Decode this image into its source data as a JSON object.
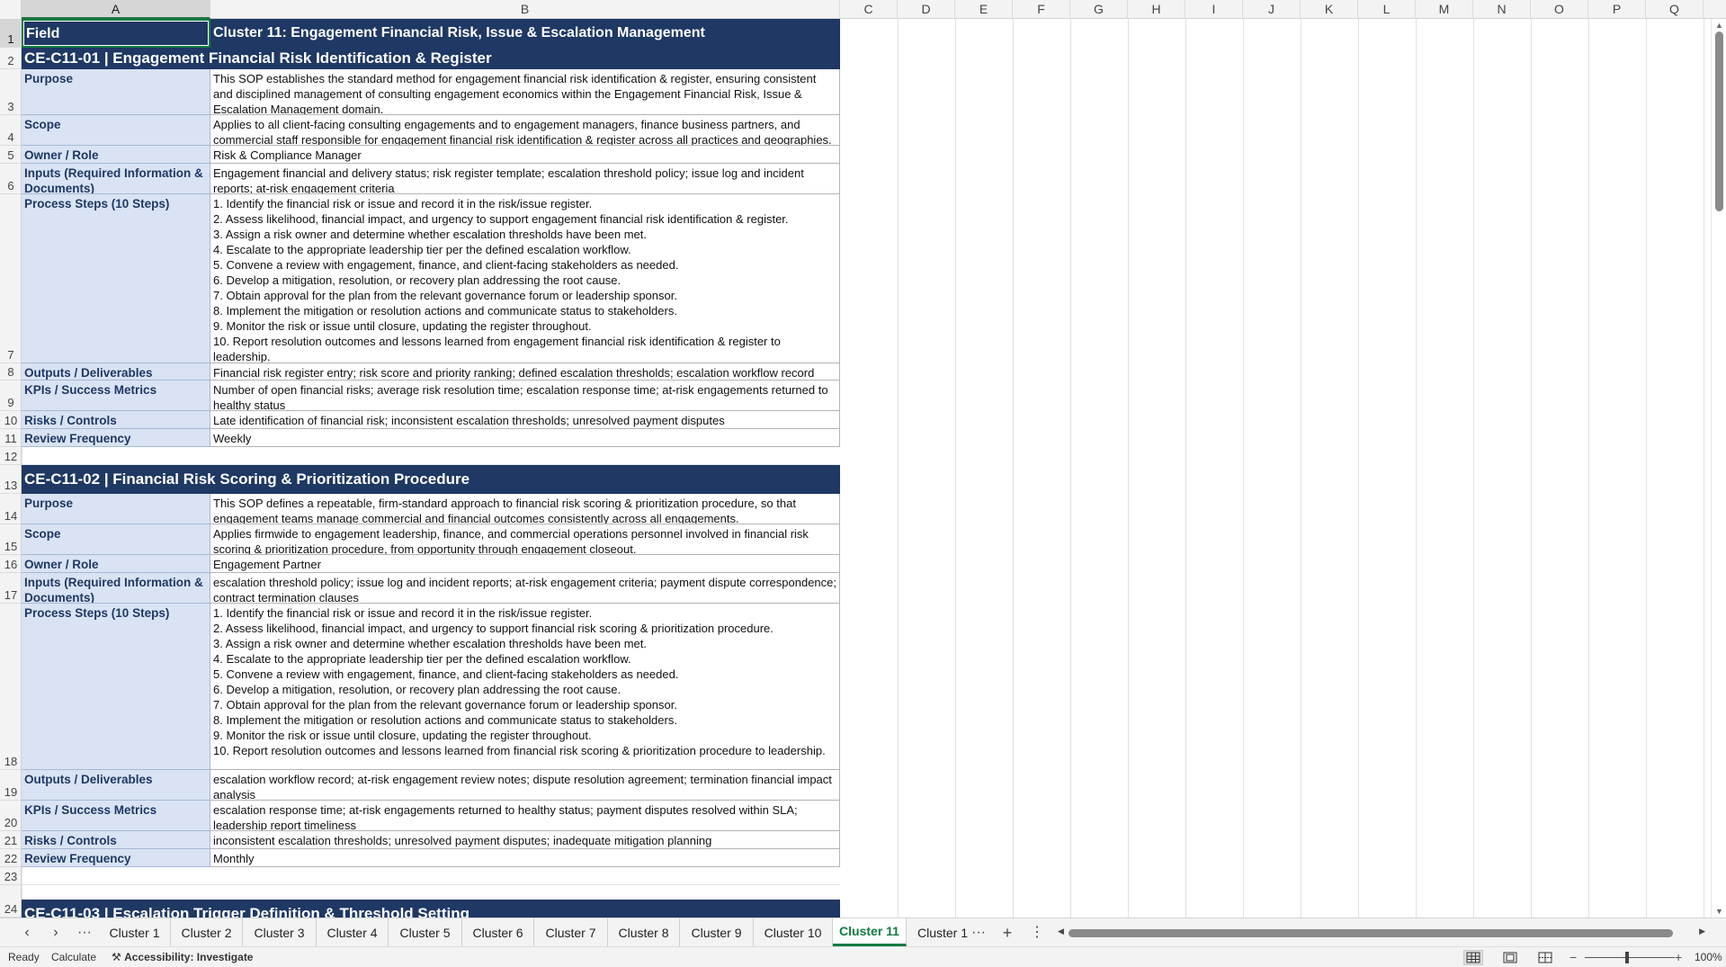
{
  "columns": [
    "A",
    "B",
    "C",
    "D",
    "E",
    "F",
    "G",
    "H",
    "I",
    "J",
    "K",
    "L",
    "M",
    "N",
    "O",
    "P",
    "Q"
  ],
  "rows": [
    "1",
    "2",
    "3",
    "4",
    "5",
    "6",
    "7",
    "8",
    "9",
    "10",
    "11",
    "12",
    "13",
    "14",
    "15",
    "16",
    "17",
    "18",
    "19",
    "20",
    "21",
    "22",
    "23",
    "24"
  ],
  "title_row": {
    "field": "Field",
    "cluster": "Cluster 11: Engagement Financial Risk, Issue & Escalation Management"
  },
  "sop1": {
    "header": "CE-C11-01  |  Engagement Financial Risk Identification & Register",
    "purpose_label": "Purpose",
    "purpose": "This SOP establishes the standard method for engagement financial risk identification & register, ensuring consistent and disciplined management of consulting engagement economics within the Engagement Financial Risk, Issue & Escalation Management domain.",
    "scope_label": "Scope",
    "scope": "Applies to all client-facing consulting engagements and to engagement managers, finance business partners, and commercial staff responsible for engagement financial risk identification & register across all practices and geographies.",
    "owner_label": "Owner / Role",
    "owner": "Risk & Compliance Manager",
    "inputs_label": "Inputs (Required Information & Documents)",
    "inputs": "Engagement financial and delivery status; risk register template; escalation threshold policy; issue log and incident reports; at-risk engagement criteria",
    "steps_label": "Process Steps (10 Steps)",
    "steps": "1. Identify the financial risk or issue and record it in the risk/issue register.\n2. Assess likelihood, financial impact, and urgency to support engagement financial risk identification & register.\n3. Assign a risk owner and determine whether escalation thresholds have been met.\n4. Escalate to the appropriate leadership tier per the defined escalation workflow.\n5. Convene a review with engagement, finance, and client-facing stakeholders as needed.\n6. Develop a mitigation, resolution, or recovery plan addressing the root cause.\n7. Obtain approval for the plan from the relevant governance forum or leadership sponsor.\n8. Implement the mitigation or resolution actions and communicate status to stakeholders.\n9. Monitor the risk or issue until closure, updating the register throughout.\n10. Report resolution outcomes and lessons learned from engagement financial risk identification & register to leadership.",
    "outputs_label": "Outputs / Deliverables",
    "outputs": "Financial risk register entry; risk score and priority ranking; defined escalation thresholds; escalation workflow record",
    "kpis_label": "KPIs / Success Metrics",
    "kpis": "Number of open financial risks; average risk resolution time; escalation response time; at-risk engagements returned to healthy status",
    "risks_label": "Risks / Controls",
    "risks": "Late identification of financial risk; inconsistent escalation thresholds; unresolved payment disputes",
    "review_label": "Review Frequency",
    "review": "Weekly"
  },
  "sop2": {
    "header": "CE-C11-02  |  Financial Risk Scoring & Prioritization Procedure",
    "purpose_label": "Purpose",
    "purpose": "This SOP defines a repeatable, firm-standard approach to financial risk scoring & prioritization procedure, so that engagement teams manage commercial and financial outcomes consistently across all engagements.",
    "scope_label": "Scope",
    "scope": "Applies firmwide to engagement leadership, finance, and commercial operations personnel involved in financial risk scoring & prioritization procedure, from opportunity through engagement closeout.",
    "owner_label": "Owner / Role",
    "owner": "Engagement Partner",
    "inputs_label": "Inputs (Required Information & Documents)",
    "inputs": "escalation threshold policy; issue log and incident reports; at-risk engagement criteria; payment dispute correspondence; contract termination clauses",
    "steps_label": "Process Steps (10 Steps)",
    "steps": "1. Identify the financial risk or issue and record it in the risk/issue register.\n2. Assess likelihood, financial impact, and urgency to support financial risk scoring & prioritization procedure.\n3. Assign a risk owner and determine whether escalation thresholds have been met.\n4. Escalate to the appropriate leadership tier per the defined escalation workflow.\n5. Convene a review with engagement, finance, and client-facing stakeholders as needed.\n6. Develop a mitigation, resolution, or recovery plan addressing the root cause.\n7. Obtain approval for the plan from the relevant governance forum or leadership sponsor.\n8. Implement the mitigation or resolution actions and communicate status to stakeholders.\n9. Monitor the risk or issue until closure, updating the register throughout.\n10. Report resolution outcomes and lessons learned from financial risk scoring & prioritization procedure to leadership.",
    "outputs_label": "Outputs / Deliverables",
    "outputs": "escalation workflow record; at-risk engagement review notes; dispute resolution agreement; termination financial impact analysis",
    "kpis_label": "KPIs / Success Metrics",
    "kpis": "escalation response time; at-risk engagements returned to healthy status; payment disputes resolved within SLA; leadership report timeliness",
    "risks_label": "Risks / Controls",
    "risks": "inconsistent escalation thresholds; unresolved payment disputes; inadequate mitigation planning",
    "review_label": "Review Frequency",
    "review": "Monthly"
  },
  "sop3": {
    "header": "CE-C11-03  |  Escalation Trigger Definition & Threshold Setting"
  },
  "tabs": [
    "Cluster 1",
    "Cluster 2",
    "Cluster 3",
    "Cluster 4",
    "Cluster 5",
    "Cluster 6",
    "Cluster 7",
    "Cluster 8",
    "Cluster 9",
    "Cluster 10",
    "Cluster 11",
    "Cluster 1"
  ],
  "active_tab": "Cluster 11",
  "status": {
    "ready": "Ready",
    "calculate": "Calculate",
    "accessibility": "Accessibility: Investigate",
    "zoom": "100%"
  }
}
